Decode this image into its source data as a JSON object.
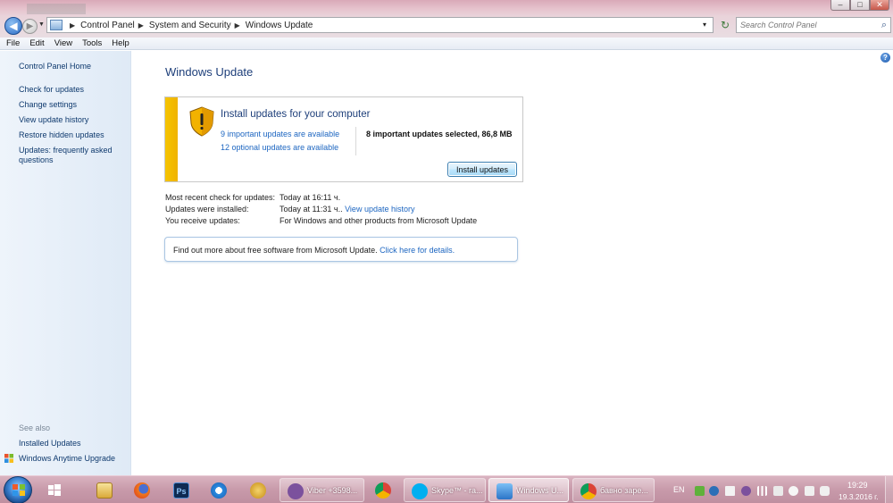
{
  "window": {
    "min_glyph": "–",
    "max_glyph": "□",
    "close_glyph": "✕"
  },
  "nav": {
    "back_glyph": "◀",
    "forward_glyph": "▶",
    "history_glyph": "▼"
  },
  "address": {
    "crumbs": [
      "Control Panel",
      "System and Security",
      "Windows Update"
    ],
    "separator": "▶",
    "dropdown_glyph": "▾",
    "refresh_glyph": "↻"
  },
  "search": {
    "placeholder": "Search Control Panel",
    "icon_glyph": "⌕"
  },
  "menu": [
    "File",
    "Edit",
    "View",
    "Tools",
    "Help"
  ],
  "sidebar": {
    "home": "Control Panel Home",
    "links": [
      "Check for updates",
      "Change settings",
      "View update history",
      "Restore hidden updates",
      "Updates: frequently asked questions"
    ],
    "see_also": "See also",
    "see_also_links": [
      "Installed Updates",
      "Windows Anytime Upgrade"
    ]
  },
  "main": {
    "title": "Windows Update",
    "help_glyph": "?",
    "panel": {
      "heading": "Install updates for your computer",
      "important_link": "9 important updates are available",
      "optional_link": "12 optional updates are available",
      "selected": "8 important updates selected, 86,8 MB",
      "install_button": "Install updates"
    },
    "info": {
      "check_label": "Most recent check for updates:",
      "check_value": "Today at 16:11 ч.",
      "installed_label": "Updates were installed:",
      "installed_value": "Today at 11:31 ч..",
      "installed_link": "View update history",
      "receive_label": "You receive updates:",
      "receive_value": "For Windows and other products from Microsoft Update"
    },
    "find_more": {
      "text": "Find out more about free software from Microsoft Update.",
      "link": "Click here for details."
    }
  },
  "taskbar": {
    "apps": [
      {
        "name": "Viber +3598...",
        "icon": "viber-icon"
      },
      {
        "name": "Skype™ - ra...",
        "icon": "skype-icon"
      },
      {
        "name": "Windows U...",
        "icon": "windows-update-icon"
      },
      {
        "name": "бавно заре...",
        "icon": "chrome-icon"
      }
    ],
    "language": "EN",
    "time": "19:29",
    "date": "19.3.2016 г."
  },
  "colors": {
    "accent_link": "#1d66c1",
    "warning_stripe": "#f5c400",
    "title_blue": "#1e3f7a"
  }
}
